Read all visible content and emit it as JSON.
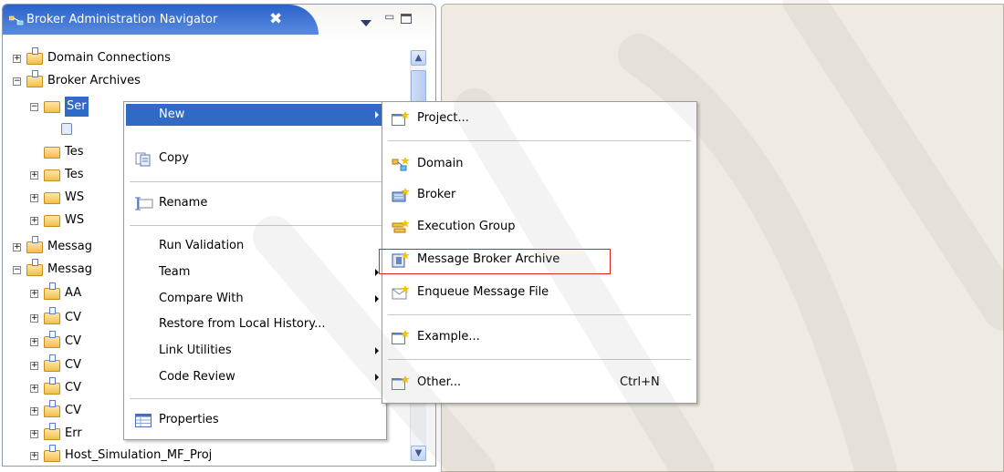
{
  "view": {
    "title": "Broker Administration Navigator",
    "close_glyph": "✖",
    "tree": [
      {
        "label": "Domain Connections",
        "level": 0,
        "expander": "+"
      },
      {
        "label": "Broker Archives",
        "level": 0,
        "expander": "−"
      },
      {
        "label": "Ser",
        "level": 1,
        "expander": "−"
      },
      {
        "label": "",
        "level": 2,
        "expander": ""
      },
      {
        "label": "Tes",
        "level": 1,
        "expander": ""
      },
      {
        "label": "Tes",
        "level": 1,
        "expander": "+"
      },
      {
        "label": "WS",
        "level": 1,
        "expander": "+"
      },
      {
        "label": "WS",
        "level": 1,
        "expander": "+"
      },
      {
        "label": "Messag",
        "level": 0,
        "expander": "+"
      },
      {
        "label": "Messag",
        "level": 0,
        "expander": "−"
      },
      {
        "label": "AA",
        "level": 1,
        "expander": "+"
      },
      {
        "label": "CV",
        "level": 1,
        "expander": "+"
      },
      {
        "label": "CV",
        "level": 1,
        "expander": "+"
      },
      {
        "label": "CV",
        "level": 1,
        "expander": "+"
      },
      {
        "label": "CV",
        "level": 1,
        "expander": "+"
      },
      {
        "label": "CV",
        "level": 1,
        "expander": "+"
      },
      {
        "label": "Err",
        "level": 1,
        "expander": "+"
      },
      {
        "label": "Host_Simulation_MF_Proj",
        "level": 1,
        "expander": "+"
      }
    ]
  },
  "context_menu": {
    "items": [
      {
        "label": "New",
        "submenu": true,
        "selected": true,
        "icon": ""
      },
      {
        "label": "Copy",
        "submenu": false,
        "icon": "copy-icon"
      },
      {
        "label": "Rename",
        "submenu": false,
        "icon": "rename-icon"
      },
      {
        "label": "Run Validation",
        "submenu": false,
        "icon": ""
      },
      {
        "label": "Team",
        "submenu": true,
        "icon": ""
      },
      {
        "label": "Compare With",
        "submenu": true,
        "icon": ""
      },
      {
        "label": "Restore from Local History...",
        "submenu": false,
        "icon": ""
      },
      {
        "label": "Link Utilities",
        "submenu": true,
        "icon": ""
      },
      {
        "label": "Code Review",
        "submenu": true,
        "icon": ""
      },
      {
        "label": "Properties",
        "submenu": false,
        "icon": "properties-icon"
      }
    ]
  },
  "submenu": {
    "items": [
      {
        "label": "Project...",
        "icon": "new-project-icon",
        "shortcut": ""
      },
      {
        "label": "Domain",
        "icon": "domain-icon",
        "shortcut": ""
      },
      {
        "label": "Broker",
        "icon": "broker-icon",
        "shortcut": ""
      },
      {
        "label": "Execution Group",
        "icon": "execution-group-icon",
        "shortcut": ""
      },
      {
        "label": "Message Broker Archive",
        "icon": "message-broker-archive-icon",
        "shortcut": "",
        "highlighted": true
      },
      {
        "label": "Enqueue Message File",
        "icon": "enqueue-message-file-icon",
        "shortcut": ""
      },
      {
        "label": "Example...",
        "icon": "new-example-icon",
        "shortcut": ""
      },
      {
        "label": "Other...",
        "icon": "new-other-icon",
        "shortcut": "Ctrl+N"
      }
    ]
  },
  "colors": {
    "tab_active": "#2a62c8",
    "menu_selection": "#316ac5",
    "highlight_border": "#e02020",
    "editor_background": "#f0ebe2"
  }
}
